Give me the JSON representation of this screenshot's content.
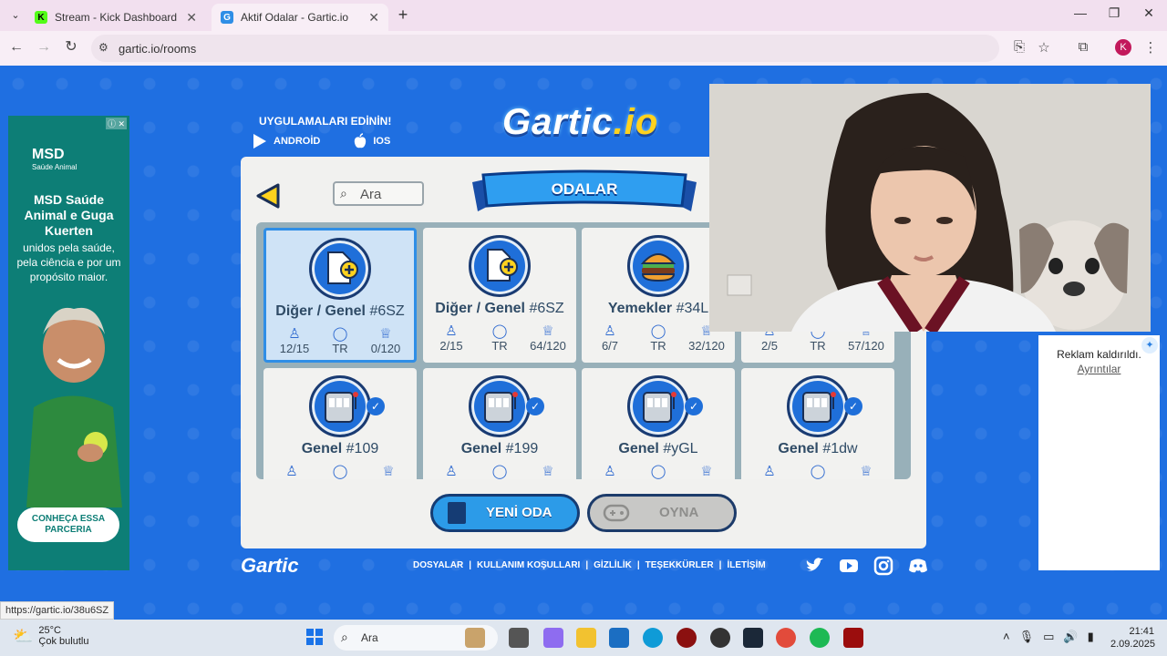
{
  "browser": {
    "tabs": [
      {
        "title": "Stream - Kick Dashboard",
        "favicon": "K",
        "active": false
      },
      {
        "title": "Aktif Odalar - Gartic.io",
        "favicon": "G",
        "active": true
      }
    ],
    "url": "gartic.io/rooms",
    "profile_initial": "K"
  },
  "app_download": {
    "title": "UYGULAMALARI EDİNİN!",
    "android": "ANDROİD",
    "ios": "IOS"
  },
  "logo": {
    "main": "Gartic",
    "suffix": ".io"
  },
  "search": {
    "placeholder": "Ara"
  },
  "banner": {
    "title": "ODALAR"
  },
  "rooms": [
    {
      "category": "Diğer / Genel",
      "code": "#6SZ",
      "players": "12/15",
      "lang": "TR",
      "points": "0/120",
      "icon": "document-plus-icon",
      "selected": true,
      "official": false
    },
    {
      "category": "Diğer / Genel",
      "code": "#6SZ",
      "players": "2/15",
      "lang": "TR",
      "points": "64/120",
      "icon": "document-plus-icon",
      "selected": false,
      "official": false
    },
    {
      "category": "Yemekler",
      "code": "#34L",
      "players": "6/7",
      "lang": "TR",
      "points": "32/120",
      "icon": "burger-icon",
      "selected": false,
      "official": false
    },
    {
      "category": "",
      "code": "",
      "players": "2/5",
      "lang": "TR",
      "points": "57/120",
      "icon": "",
      "selected": false,
      "official": false
    },
    {
      "category": "Genel",
      "code": "#109",
      "icon": "slot-machine-icon",
      "official": true
    },
    {
      "category": "Genel",
      "code": "#199",
      "icon": "slot-machine-icon",
      "official": true
    },
    {
      "category": "Genel",
      "code": "#yGL",
      "icon": "slot-machine-icon",
      "official": true
    },
    {
      "category": "Genel",
      "code": "#1dw",
      "icon": "slot-machine-icon",
      "official": true
    }
  ],
  "buttons": {
    "new_room": "YENİ ODA",
    "play": "OYNA"
  },
  "footer": {
    "logo": "Gartic",
    "links": [
      "DOSYALAR",
      "KULLANIM KOŞULLARI",
      "GİZLİLİK",
      "TEŞEKKÜRLER",
      "İLETİŞİM"
    ]
  },
  "ad_left": {
    "brand": "MSD",
    "brand_sub": "Saúde Animal",
    "headline": "MSD Saúde Animal e Guga Kuerten",
    "sub": "unidos pela saúde, pela ciência e por um propósito maior.",
    "cta": "CONHEÇA ESSA PARCERIA"
  },
  "ad_right": {
    "removed": "Reklam kaldırıldı.",
    "details": "Ayrıntılar"
  },
  "status_url": "https://gartic.io/38u6SZ",
  "taskbar": {
    "temp": "25°C",
    "weather": "Çok bulutlu",
    "search": "Ara",
    "time": "21:41",
    "date": "2.09.2025"
  },
  "colors": {
    "page_bg": "#1f6fe1",
    "accent": "#2c9be8",
    "panel": "#f1f1ef",
    "selected_room": "#cfe3f6"
  }
}
